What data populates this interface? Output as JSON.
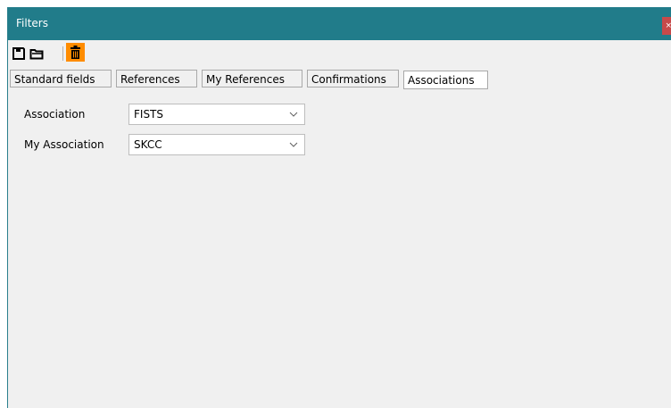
{
  "window": {
    "title": "Filters",
    "close_glyph": "×"
  },
  "toolbar": {
    "icons": [
      "save-icon",
      "open-folder-icon",
      "trash-icon"
    ],
    "trash_accent": "#ff8c00"
  },
  "tabs": [
    {
      "label": "Standard fields",
      "active": false
    },
    {
      "label": "References",
      "active": false
    },
    {
      "label": "My References",
      "active": false
    },
    {
      "label": "Confirmations",
      "active": false
    },
    {
      "label": "Associations",
      "active": true
    }
  ],
  "form": {
    "association": {
      "label": "Association",
      "value": "FISTS"
    },
    "my_association": {
      "label": "My Association",
      "value": "SKCC"
    }
  },
  "colors": {
    "titlebar": "#217c8a",
    "window_bg": "#f0f0f0",
    "close": "#c74a4a"
  }
}
